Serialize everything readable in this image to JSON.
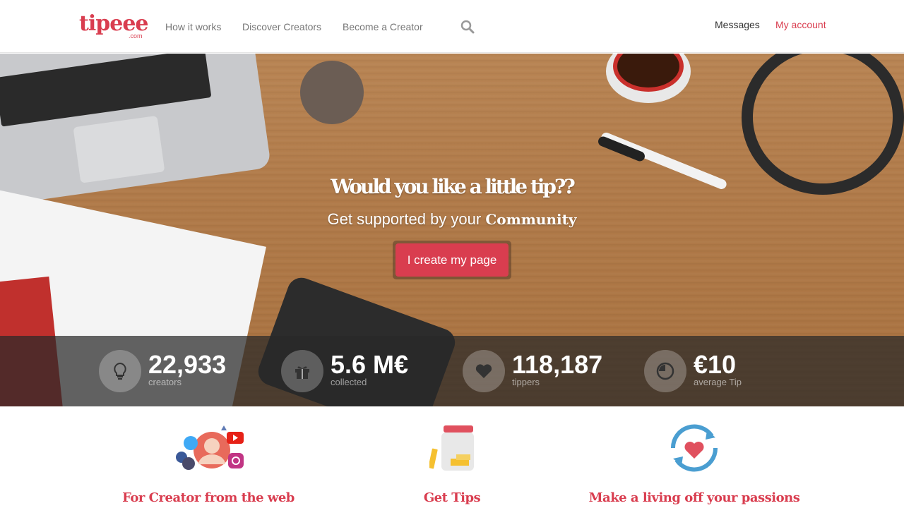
{
  "header": {
    "logo_text": "tipeee",
    "logo_sub": ".com",
    "nav": {
      "how_it_works": "How it works",
      "discover": "Discover Creators",
      "become": "Become a Creator"
    },
    "messages": "Messages",
    "my_account": "My account"
  },
  "hero": {
    "title": "Would you like a little tip??",
    "subtitle_prefix": "Get supported by your",
    "subtitle_bold": "Community",
    "cta": "I create my page"
  },
  "stats": [
    {
      "icon": "lightbulb-icon",
      "value": "22,933",
      "label": "creators"
    },
    {
      "icon": "gift-icon",
      "value": "5.6 M€",
      "label": "collected"
    },
    {
      "icon": "heart-icon",
      "value": "118,187",
      "label": "tippers"
    },
    {
      "icon": "pie-chart-icon",
      "value": "€10",
      "label": "average Tip"
    }
  ],
  "features": [
    {
      "icon": "social-creator-icon",
      "title": "For Creator from the web"
    },
    {
      "icon": "tip-jar-icon",
      "title": "Get Tips"
    },
    {
      "icon": "heart-cycle-icon",
      "title": "Make a living off your passions"
    }
  ],
  "colors": {
    "brand": "#d93d4f"
  }
}
